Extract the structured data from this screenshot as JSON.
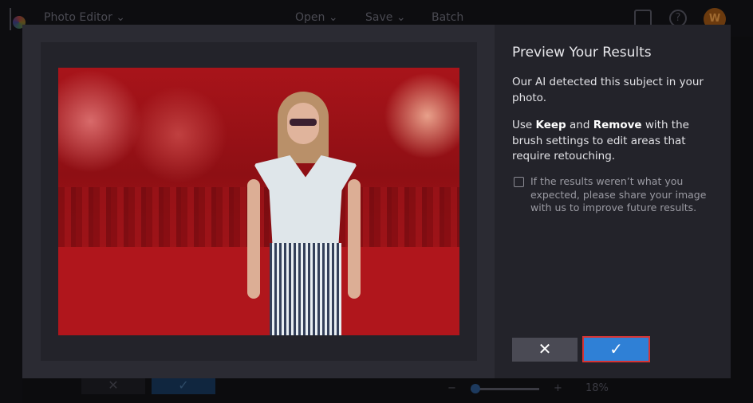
{
  "topbar": {
    "app_menu": "Photo Editor ⌄",
    "open": "Open ⌄",
    "save": "Save ⌄",
    "batch": "Batch",
    "avatar_initial": "W",
    "help": "?"
  },
  "bottombar": {
    "cancel": "✕",
    "apply": "✓",
    "zoom": "18%",
    "minus": "−",
    "plus": "+"
  },
  "modal": {
    "title": "Preview Your Results",
    "description": "Our AI detected this subject in your photo.",
    "instr_prefix": "Use ",
    "keep": "Keep",
    "instr_mid": " and ",
    "remove": "Remove",
    "instr_suffix": " with the brush settings to edit areas that require retouching.",
    "feedback_label": "If the results weren’t what you expected, please share your image with us to improve future results.",
    "feedback_checked": false,
    "cancel_icon": "✕",
    "confirm_icon": "✓"
  },
  "colors": {
    "accent": "#2f80d6",
    "mask": "#a8141a"
  }
}
